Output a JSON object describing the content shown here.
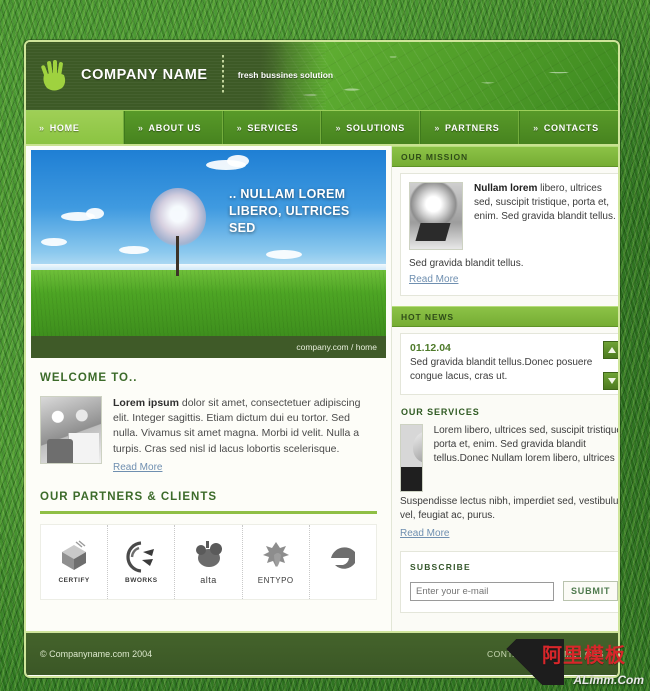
{
  "header": {
    "logo_icon": "hand-leaf-icon",
    "company_name": "COMPANY NAME",
    "tagline": "fresh bussines solution"
  },
  "nav": {
    "chevron": "»",
    "items": [
      {
        "label": "HOME",
        "active": true
      },
      {
        "label": "ABOUT US",
        "active": false
      },
      {
        "label": "SERVICES",
        "active": false
      },
      {
        "label": "SOLUTIONS",
        "active": false
      },
      {
        "label": "PARTNERS",
        "active": false
      },
      {
        "label": "CONTACTS",
        "active": false
      }
    ]
  },
  "hero": {
    "title": ".. NULLAM LOREM LIBERO, ULTRICES SED",
    "breadcrumb": "company.com / home",
    "image_alt": "lone-tree-in-green-field-under-blue-sky"
  },
  "welcome": {
    "title": "WELCOME TO..",
    "image_alt": "two-men-at-desk-photo",
    "lead": "Lorem ipsum",
    "body": " dolor sit amet, consectetuer adipiscing elit. Integer sagittis. Etiam dictum dui eu tortor. Sed nulla. Vivamus sit amet magna. Morbi id velit. Nulla a turpis. Cras sed nisl id lacus lobortis scelerisque.",
    "read_more": "Read More"
  },
  "partners": {
    "title": "OUR PARTNERS & CLIENTS",
    "logos": [
      {
        "name": "CERTIFY",
        "mark": "stacked-chevron-cube-icon"
      },
      {
        "name": "BWORKS",
        "mark": "swoosh-arrow-icon"
      },
      {
        "name": "alta",
        "mark": "blob-shape-icon"
      },
      {
        "name": "ENTYPO",
        "mark": "heraldic-lion-icon"
      },
      {
        "name": "",
        "mark": "circle-swirl-icon"
      }
    ]
  },
  "mission": {
    "band_title": "OUR MISSION",
    "image_alt": "globe-and-laptop-photo",
    "lead": "Nullam lorem",
    "body": " libero, ultrices sed, suscipit tristique, porta et, enim. Sed gravida blandit tellus.",
    "footer_text": "Sed gravida blandit tellus.",
    "read_more": "Read More"
  },
  "hot_news": {
    "band_title": "HOT NEWS",
    "date": "01.12.04",
    "text": "Sed gravida blandit tellus.Donec posuere congue lacus, cras ut.",
    "scroll_up": "scroll-up-arrow",
    "scroll_down": "scroll-down-arrow"
  },
  "services": {
    "title": "OUR SERVICES",
    "image_alt": "man-at-laptop-photo",
    "body": "Lorem libero, ultrices sed, suscipit tristique, porta et, enim. Sed gravida blandit tellus.Donec Nullam lorem libero, ultrices",
    "footer_text": "Suspendisse lectus nibh, imperdiet sed, vestibulum vel, feugiat ac, purus.",
    "read_more": "Read More"
  },
  "subscribe": {
    "title": "SUBSCRIBE",
    "placeholder": "Enter your e-mail",
    "value": "",
    "submit_label": "SUBMIT"
  },
  "footer": {
    "copyright": "© Companyname.com  2004",
    "links": "CONTACTS | XHTML | CSS",
    "watermark_cn": "阿里模板",
    "watermark_en": "ALimm.Com"
  },
  "colors": {
    "brand_green": "#8cc247",
    "dark_green": "#3d5a26",
    "nav_green": "#4a8522",
    "link_blue": "#6f8fb0"
  }
}
